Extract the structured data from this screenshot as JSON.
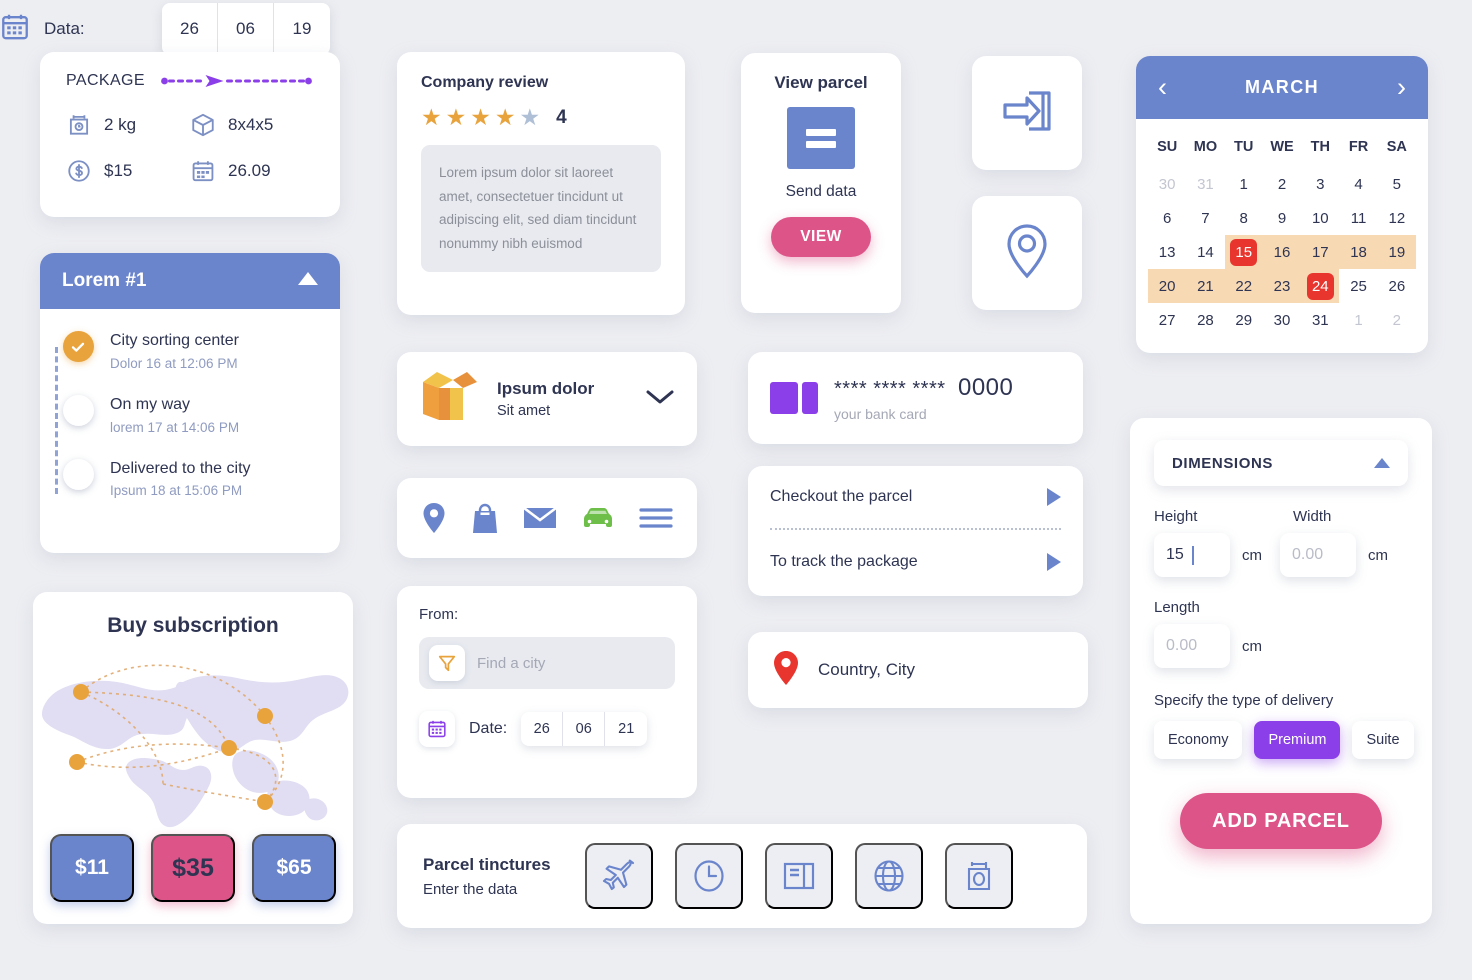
{
  "package": {
    "title": "PACKAGE",
    "items": [
      {
        "icon": "scale-icon",
        "value": "2 kg"
      },
      {
        "icon": "cube-icon",
        "value": "8x4x5"
      },
      {
        "icon": "dollar-coin-icon",
        "value": "$15"
      },
      {
        "icon": "calendar-icon",
        "value": "26.09"
      }
    ]
  },
  "timeline": {
    "header": "Lorem #1",
    "collapse_icon": "triangle-up-icon",
    "steps": [
      {
        "title": "City sorting center",
        "time": "Dolor 16 at 12:06 PM",
        "done": true
      },
      {
        "title": "On my way",
        "time": "lorem 17 at 14:06 PM",
        "done": false
      },
      {
        "title": "Delivered to the city",
        "time": "Ipsum 18 at 15:06 PM",
        "done": false
      }
    ]
  },
  "subscription": {
    "title": "Buy subscription",
    "prices": [
      {
        "label": "$11",
        "style": "blue"
      },
      {
        "label": "$35",
        "style": "pink"
      },
      {
        "label": "$65",
        "style": "blue"
      }
    ]
  },
  "review": {
    "title": "Company review",
    "rating": 4,
    "rating_label": "4",
    "stars_total": 5,
    "text": "Lorem ipsum dolor sit  laoreet amet, consectetuer  tincidunt ut adipiscing elit, sed diam  tincidunt nonummy nibh euismod"
  },
  "ipsum_card": {
    "icon": "open-box-icon",
    "title": "Ipsum dolor",
    "subtitle": "Sit amet",
    "chevron": "chevron-down-icon"
  },
  "icon_row": [
    {
      "name": "map-pin-icon"
    },
    {
      "name": "shopping-bag-icon"
    },
    {
      "name": "envelope-icon"
    },
    {
      "name": "car-icon"
    },
    {
      "name": "menu-icon"
    }
  ],
  "from_form": {
    "label": "From:",
    "city_placeholder": "Find a city",
    "city_icon": "send-plane-icon",
    "date_icon": "calendar-icon",
    "date_label": "Date:",
    "date_parts": [
      "26",
      "06",
      "21"
    ]
  },
  "tinctures": {
    "title": "Parcel tinctures",
    "subtitle": "Enter the data",
    "buttons": [
      {
        "icon": "airplane-icon"
      },
      {
        "icon": "clock-icon"
      },
      {
        "icon": "document-icon"
      },
      {
        "icon": "globe-icon"
      },
      {
        "icon": "scale-icon"
      }
    ]
  },
  "view_parcel": {
    "title": "View parcel",
    "icon": "parcel-box-icon",
    "subtitle": "Send data",
    "button": "VIEW"
  },
  "square_buttons": [
    {
      "icon": "login-arrow-icon"
    },
    {
      "icon": "location-pin-outline-icon"
    }
  ],
  "bank_card": {
    "icon": "credit-card-icon",
    "masked": "**** **** ****",
    "last4": "0000",
    "caption": "your bank card"
  },
  "checkout_list": [
    {
      "label": "Checkout the parcel",
      "icon": "play-arrow-icon"
    },
    {
      "label": "To track the package",
      "icon": "play-arrow-icon"
    }
  ],
  "country_row": {
    "icon": "red-pin-icon",
    "label": "Country, City"
  },
  "data_row": {
    "icon": "calendar-icon",
    "label": "Data:",
    "parts": [
      "26",
      "06",
      "19"
    ]
  },
  "calendar": {
    "month": "MARCH",
    "prev_icon": "chevron-left-icon",
    "next_icon": "chevron-right-icon",
    "dows": [
      "SU",
      "MO",
      "TU",
      "WE",
      "TH",
      "FR",
      "SA"
    ],
    "weeks": [
      [
        {
          "d": "30",
          "muted": true
        },
        {
          "d": "31",
          "muted": true
        },
        {
          "d": "1"
        },
        {
          "d": "2"
        },
        {
          "d": "3"
        },
        {
          "d": "4"
        },
        {
          "d": "5"
        }
      ],
      [
        {
          "d": "6"
        },
        {
          "d": "7"
        },
        {
          "d": "8"
        },
        {
          "d": "9"
        },
        {
          "d": "10"
        },
        {
          "d": "11"
        },
        {
          "d": "12"
        }
      ],
      [
        {
          "d": "13"
        },
        {
          "d": "14"
        },
        {
          "d": "15",
          "selected": true,
          "range": true
        },
        {
          "d": "16",
          "range": true
        },
        {
          "d": "17",
          "range": true
        },
        {
          "d": "18",
          "range": true
        },
        {
          "d": "19",
          "range": true
        }
      ],
      [
        {
          "d": "20",
          "range": true
        },
        {
          "d": "21",
          "range": true
        },
        {
          "d": "22",
          "range": true
        },
        {
          "d": "23",
          "range": true
        },
        {
          "d": "24",
          "selected": true,
          "range": true
        },
        {
          "d": "25"
        },
        {
          "d": "26"
        }
      ],
      [
        {
          "d": "27"
        },
        {
          "d": "28"
        },
        {
          "d": "29"
        },
        {
          "d": "30"
        },
        {
          "d": "31"
        },
        {
          "d": "1",
          "muted": true
        },
        {
          "d": "2",
          "muted": true
        }
      ]
    ]
  },
  "dimensions": {
    "header": "DIMENSIONS",
    "collapse_icon": "triangle-up-icon",
    "height_label": "Height",
    "height_value": "15",
    "width_label": "Width",
    "width_placeholder": "0.00",
    "length_label": "Length",
    "length_placeholder": "0.00",
    "unit": "cm",
    "delivery_label": "Specify the type of delivery",
    "delivery_types": [
      {
        "label": "Economy",
        "selected": false
      },
      {
        "label": "Premium",
        "selected": true
      },
      {
        "label": "Suite",
        "selected": false
      }
    ],
    "add_button": "ADD PARCEL"
  },
  "colors": {
    "background": "#edeef2",
    "blue": "#6b85cc",
    "pink": "#dd5588",
    "purple": "#8b3fe8",
    "orange": "#e8a33d",
    "red": "#e8362e",
    "range": "#f7d9b4",
    "green": "#6dbf49",
    "text": "#2e3452",
    "muted": "#8f9bc0"
  }
}
